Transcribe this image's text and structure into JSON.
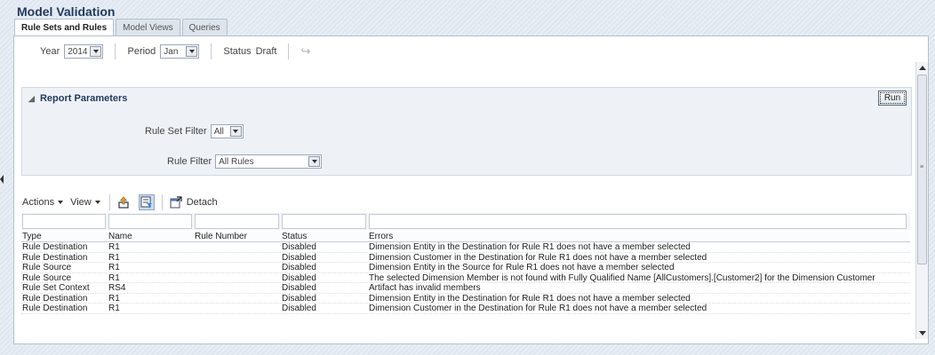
{
  "page": {
    "title": "Model Validation"
  },
  "tabs": [
    {
      "label": "Rule Sets and Rules",
      "active": true
    },
    {
      "label": "Model Views",
      "active": false
    },
    {
      "label": "Queries",
      "active": false
    }
  ],
  "toolbar": {
    "year_label": "Year",
    "year_value": "2014",
    "period_label": "Period",
    "period_value": "Jan",
    "status_label": "Status",
    "status_value": "Draft",
    "redo_icon": "redo-icon"
  },
  "report": {
    "title": "Report Parameters",
    "run_label": "Run",
    "rule_set_filter_label": "Rule Set Filter",
    "rule_set_filter_value": "All",
    "rule_filter_label": "Rule Filter",
    "rule_filter_value": "All Rules"
  },
  "table_toolbar": {
    "actions_label": "Actions",
    "view_label": "View",
    "detach_label": "Detach"
  },
  "table": {
    "columns": [
      "Type",
      "Name",
      "Rule Number",
      "Status",
      "Errors"
    ],
    "rows": [
      [
        "Rule Destination",
        "R1",
        "",
        "Disabled",
        "Dimension Entity in the Destination for Rule R1 does not have a member selected"
      ],
      [
        "Rule Destination",
        "R1",
        "",
        "Disabled",
        "Dimension Customer in the Destination for Rule R1 does not have a member selected"
      ],
      [
        "Rule Source",
        "R1",
        "",
        "Disabled",
        "Dimension Entity in the Source for Rule R1 does not have a member selected"
      ],
      [
        "Rule Source",
        "R1",
        "",
        "Disabled",
        "The selected Dimension Member is not found with Fully Qualified Name [AllCustomers].[Customer2] for the Dimension Customer"
      ],
      [
        "Rule Set Context",
        "RS4",
        "",
        "Disabled",
        "Artifact has invalid members"
      ],
      [
        "Rule Destination",
        "R1",
        "",
        "Disabled",
        "Dimension Entity in the Destination for Rule R1 does not have a member selected"
      ],
      [
        "Rule Destination",
        "R1",
        "",
        "Disabled",
        "Dimension Customer in the Destination for Rule R1 does not have a member selected"
      ]
    ]
  }
}
